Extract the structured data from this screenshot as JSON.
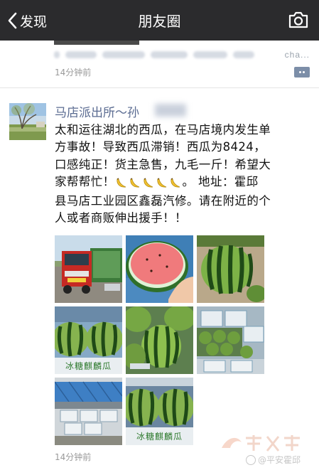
{
  "navbar": {
    "back_label": "发现",
    "title": "朋友圈"
  },
  "prev_post": {
    "link_tail": "cha...",
    "time": "14分钟前"
  },
  "post": {
    "author": "马店派出所～孙",
    "lines": [
      "太和运往湖北的西瓜，在马店境内发生单",
      "方事故！导致西瓜滞销！西瓜为8424，",
      "口感纯正！货主急售，九毛一斤！希望大",
      "家帮帮忙！",
      "县马店工业园区鑫磊汽修。请在附近的个",
      "人或者商贩伸出援手！！"
    ],
    "line4_tail": "。  地址：霍邱",
    "photo_captions": [
      "冰糖麒麟瓜",
      "冰糖麒麟瓜"
    ],
    "time": "14分钟前"
  },
  "watermark": {
    "handle": "@平安霍邱"
  },
  "colors": {
    "navbar": "#2b2b2d",
    "author": "#5a6b91",
    "timestamp": "#9a9a9a"
  },
  "icons": [
    "chevron-left-icon",
    "camera-icon",
    "comment-icon",
    "banana-emoji"
  ]
}
